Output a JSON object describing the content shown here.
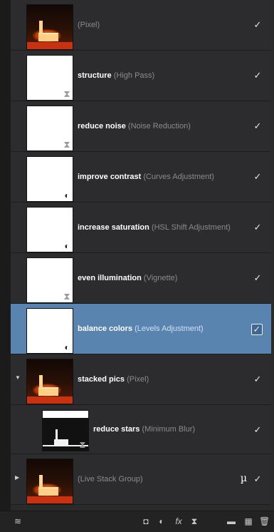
{
  "layers": [
    {
      "name": "",
      "type": "(Pixel)",
      "thumb": "photo",
      "badge": "",
      "checked": true
    },
    {
      "name": "structure",
      "type": "(High Pass)",
      "thumb": "white",
      "badge": "hourglass",
      "checked": true
    },
    {
      "name": "reduce noise",
      "type": "(Noise Reduction)",
      "thumb": "white",
      "badge": "hourglass",
      "checked": true
    },
    {
      "name": "improve contrast",
      "type": "(Curves Adjustment)",
      "thumb": "white",
      "badge": "adjustment",
      "checked": true
    },
    {
      "name": "increase saturation",
      "type": "(HSL Shift Adjustment)",
      "thumb": "white",
      "badge": "adjustment",
      "checked": true
    },
    {
      "name": "even illumination",
      "type": "(Vignette)",
      "thumb": "white",
      "badge": "hourglass",
      "checked": true
    },
    {
      "name": "balance colors",
      "type": "(Levels Adjustment)",
      "thumb": "white",
      "badge": "adjustment",
      "checked": true,
      "selected": true
    },
    {
      "name": "stacked pics",
      "type": "(Pixel)",
      "thumb": "photo",
      "badge": "",
      "checked": true,
      "expanded": true
    },
    {
      "name": "reduce stars",
      "type": "(Minimum Blur)",
      "thumb": "stars",
      "badge": "hourglass",
      "checked": true,
      "child": true
    },
    {
      "name": "",
      "type": "(Live Stack Group)",
      "thumb": "photo",
      "badge": "",
      "checked": true,
      "collapsed": true,
      "mu": "µ"
    }
  ],
  "icons": {
    "check": "✓",
    "hourglass": "⧗",
    "adjustment": "◐",
    "expanded": "▼",
    "collapsed": "▶",
    "cursor": "↖"
  },
  "toolbar": {
    "layers_icon": "layers-icon",
    "mask_icon": "mask-icon",
    "adjustment_icon": "adjustment-icon",
    "fx_label": "fx",
    "filter_icon": "hourglass-icon",
    "folder_icon": "folder-icon",
    "checker_icon": "checker-icon",
    "trash_icon": "trash-icon"
  },
  "colors": {
    "selected_row": "#5a84b0",
    "row_bg": "#2c2c2e"
  }
}
